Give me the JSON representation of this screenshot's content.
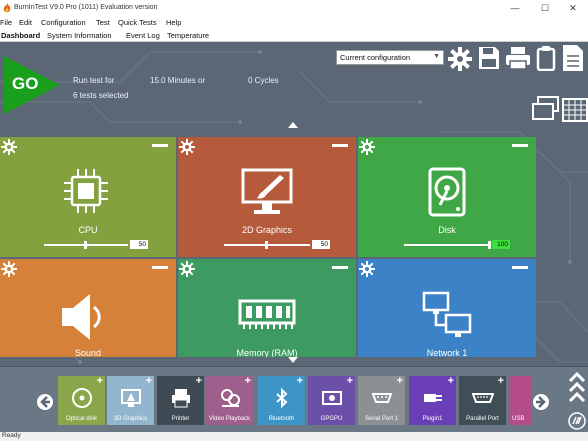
{
  "window": {
    "title": "BurnInTest V9.0 Pro (1011) Evaluation version",
    "minimize_glyph": "—",
    "maximize_glyph": "☐",
    "close_glyph": "✕"
  },
  "menu": {
    "file": "File",
    "edit": "Edit",
    "configuration": "Configuration",
    "test": "Test",
    "quick_tests": "Quick Tests",
    "help": "Help"
  },
  "tabs": {
    "dashboard": "Dashboard",
    "system_information": "System Information",
    "event_log": "Event Log",
    "temperature": "Temperature"
  },
  "run": {
    "go_label": "GO",
    "run_test_for": "Run test for",
    "duration": "15.0 Minutes or",
    "cycles": "0 Cycles",
    "tests_selected": "6 tests selected"
  },
  "config": {
    "selected": "Current configuration"
  },
  "tiles": [
    {
      "label": "CPU",
      "value": "50",
      "level": 0.5,
      "color": "#83a13f"
    },
    {
      "label": "2D Graphics",
      "value": "50",
      "level": 0.5,
      "color": "#b65a3c"
    },
    {
      "label": "Disk",
      "value": "100",
      "level": 1.0,
      "color": "#3fa745"
    },
    {
      "label": "Sound",
      "value": "",
      "level": 0,
      "color": "#d5813a"
    },
    {
      "label": "Memory (RAM)",
      "value": "",
      "level": 0,
      "color": "#3d9a60"
    },
    {
      "label": "Network 1",
      "value": "",
      "level": 0,
      "color": "#3b82c6"
    }
  ],
  "tray": {
    "items": [
      {
        "label": "Optical disk",
        "color": "#8aa64a",
        "icon": "optical-disk-icon"
      },
      {
        "label": "3D Graphics",
        "color": "#93b6cf",
        "icon": "3d-graphics-icon"
      },
      {
        "label": "Printer",
        "color": "#3e4b55",
        "icon": "printer-icon"
      },
      {
        "label": "Video Playback",
        "color": "#9e5f8d",
        "icon": "video-playback-icon"
      },
      {
        "label": "Bluetooth",
        "color": "#3d94c6",
        "icon": "bluetooth-icon"
      },
      {
        "label": "GPGPU",
        "color": "#6b4fa8",
        "icon": "gpgpu-icon"
      },
      {
        "label": "Serial Port 1",
        "color": "#8c9092",
        "icon": "serial-port-icon"
      },
      {
        "label": "Plugin1",
        "color": "#6a3fb5",
        "icon": "plugin-icon"
      },
      {
        "label": "Parallel Port",
        "color": "#3f4e57",
        "icon": "parallel-port-icon"
      },
      {
        "label": "USB",
        "color": "#b54c8a",
        "icon": "usb-icon"
      }
    ]
  },
  "status": {
    "text": "Ready"
  }
}
